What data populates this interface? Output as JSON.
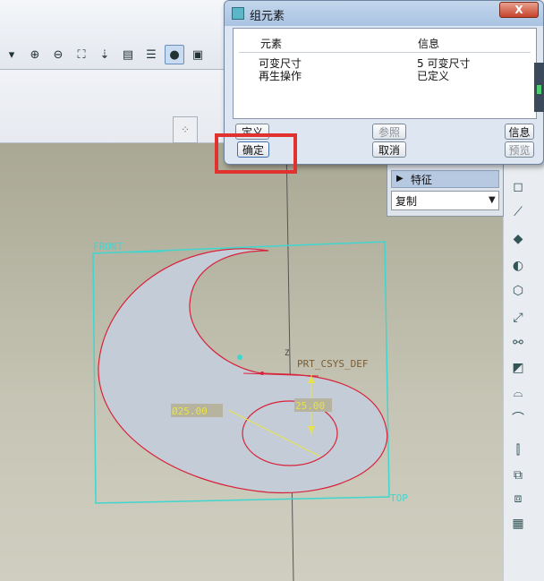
{
  "toolbar": {
    "icons": [
      "chevron-down-icon",
      "zoom-in-icon",
      "zoom-out-icon",
      "zoom-fit-icon",
      "reorient-icon",
      "view-list-icon",
      "layers-icon",
      "display-style-icon",
      "window-icon"
    ]
  },
  "dialog": {
    "title": "组元素",
    "close_label": "X",
    "table": {
      "headers": [
        "元素",
        "信息"
      ],
      "rows": [
        {
          "element": "可变尺寸",
          "info": "5 可变尺寸"
        },
        {
          "element": "再生操作",
          "info": "已定义"
        }
      ]
    },
    "buttons": {
      "define": "定义",
      "reference": "参照",
      "info": "信息",
      "ok": "确定",
      "cancel": "取消",
      "preview": "预览"
    }
  },
  "features_panel": {
    "header": "特征",
    "selected": "复制"
  },
  "model": {
    "front_label": "FRONT",
    "top_label": "TOP",
    "csys_label": "PRT_CSYS_DEF",
    "csys_z": "Z",
    "diameter_label": "Ø25.00",
    "dim_label": "25.00"
  },
  "colors": {
    "highlight": "#e0322e",
    "datum_plane": "#3fd6cf",
    "sketch": "#d7223a",
    "fill": "#c4ccd7",
    "dimension": "#e8e24a"
  }
}
